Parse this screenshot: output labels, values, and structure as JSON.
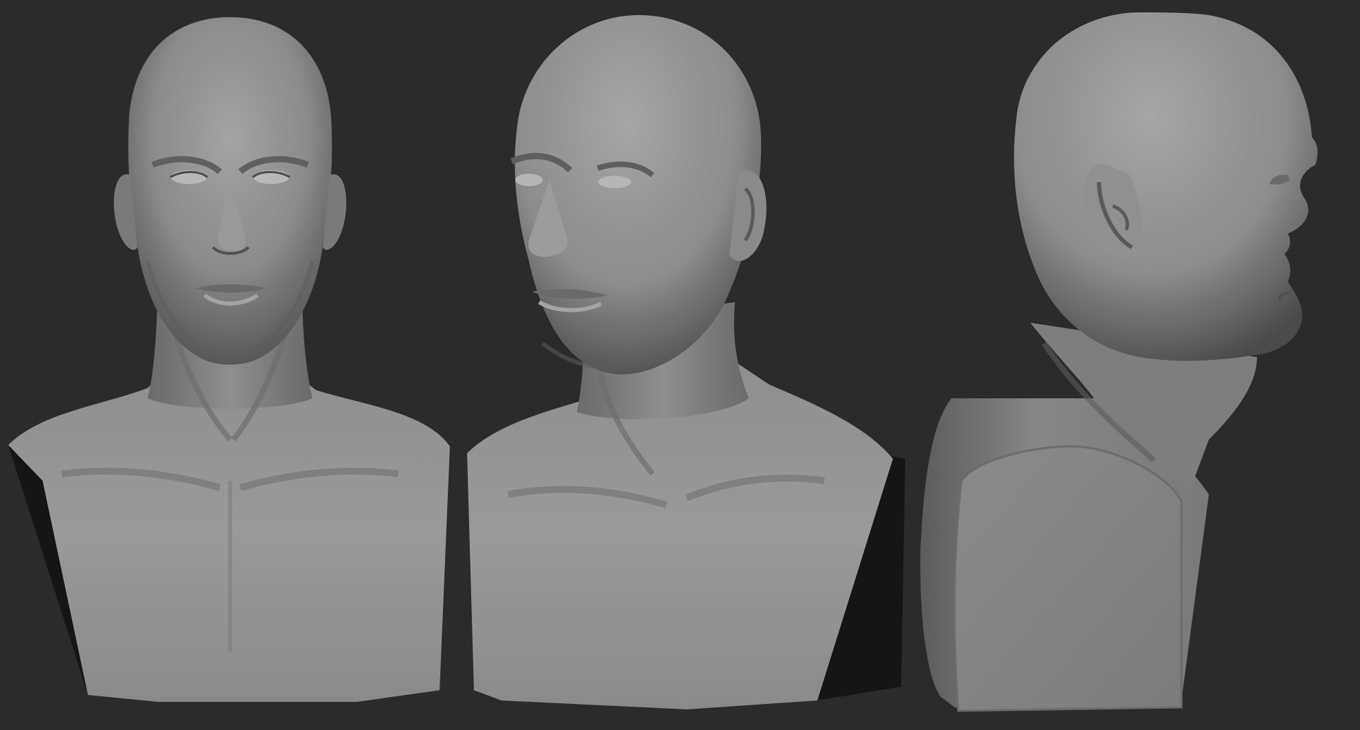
{
  "scene": {
    "background_color": "#2b2b2d",
    "clay_color": "#8c8c8e",
    "shadow_color": "#101012",
    "views": [
      {
        "name": "front",
        "kind": "bust-sculpt"
      },
      {
        "name": "three-quarter",
        "kind": "bust-sculpt"
      },
      {
        "name": "profile",
        "kind": "bust-sculpt"
      }
    ]
  }
}
